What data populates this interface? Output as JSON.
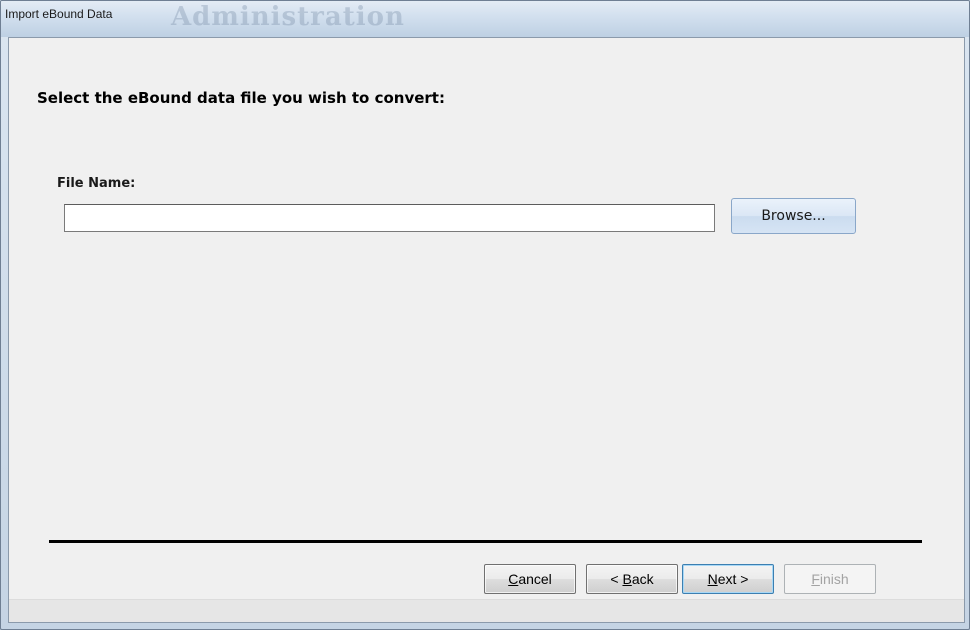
{
  "window": {
    "title": "Import eBound Data",
    "background_title": "Administration"
  },
  "page": {
    "heading": "Select the eBound data file you wish to convert:"
  },
  "file": {
    "label": "File Name:",
    "value": "",
    "browse_label": "Browse..."
  },
  "nav": {
    "cancel": {
      "mnemonic": "C",
      "rest": "ancel"
    },
    "back": {
      "prefix": "< ",
      "mnemonic": "B",
      "rest": "ack"
    },
    "next": {
      "mnemonic": "N",
      "rest": "ext >"
    },
    "finish": {
      "mnemonic": "F",
      "rest": "inish"
    }
  },
  "colors": {
    "client_bg": "#f0f0f0",
    "browse_border": "#8aa7c9",
    "separator": "#000000",
    "disabled_text": "#a3a3a3"
  }
}
